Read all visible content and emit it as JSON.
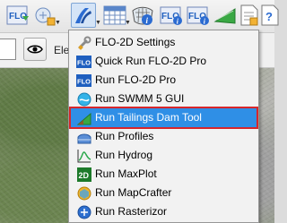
{
  "toolbar": {
    "buttons": [
      {
        "name": "flo2d-project-icon",
        "text": "FLO"
      },
      {
        "name": "grid-tools-icon",
        "text": ""
      },
      {
        "name": "flo2d-run-icon",
        "text": ""
      },
      {
        "name": "grid-table-icon",
        "text": ""
      },
      {
        "name": "info-tool-icon",
        "text": ""
      },
      {
        "name": "flo-info-icon",
        "text": "FLO"
      },
      {
        "name": "flo-channel-info-icon",
        "text": "FLO"
      },
      {
        "name": "profile-tool-icon",
        "text": ""
      },
      {
        "name": "report-icon",
        "text": ""
      },
      {
        "name": "help-icon",
        "text": "?"
      }
    ]
  },
  "row2": {
    "label": "Elev"
  },
  "menu": {
    "items": [
      {
        "label": "FLO-2D Settings",
        "icon": "wrench-icon"
      },
      {
        "label": "Quick Run FLO-2D Pro",
        "icon": "flo-quick-run-icon",
        "icon_text": "FLO"
      },
      {
        "label": "Run FLO-2D Pro",
        "icon": "flo-run-icon",
        "icon_text": "FLO"
      },
      {
        "label": "Run SWMM 5 GUI",
        "icon": "swmm-icon"
      },
      {
        "label": "Run Tailings Dam Tool",
        "icon": "tailings-dam-icon"
      },
      {
        "label": "Run Profiles",
        "icon": "profiles-icon"
      },
      {
        "label": "Run Hydrog",
        "icon": "hydrograph-icon"
      },
      {
        "label": "Run MaxPlot",
        "icon": "maxplot-icon",
        "icon_text": "2D"
      },
      {
        "label": "Run MapCrafter",
        "icon": "mapcrafter-icon"
      },
      {
        "label": "Run Rasterizor",
        "icon": "rasterizor-icon"
      }
    ],
    "highlighted_index": 4
  },
  "colors": {
    "highlight": "#2f8fe6",
    "highlight_border": "#d7262b",
    "flo_blue": "#1f5fbf"
  }
}
